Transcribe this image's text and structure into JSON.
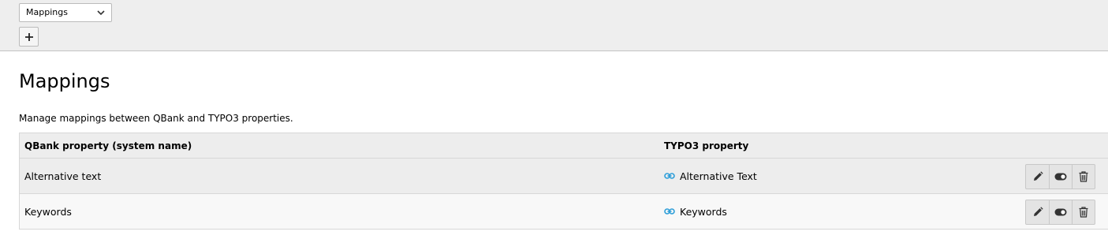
{
  "docheader": {
    "module_select": {
      "value": "Mappings"
    },
    "add_button": {
      "icon": "plus-icon"
    }
  },
  "page": {
    "title": "Mappings",
    "description": "Manage mappings between QBank and TYPO3 properties."
  },
  "table": {
    "columns": [
      "QBank property (system name)",
      "TYPO3 property"
    ],
    "rows": [
      {
        "qbank_property": "Alternative text",
        "typo3_property": "Alternative Text"
      },
      {
        "qbank_property": "Keywords",
        "typo3_property": "Keywords"
      }
    ],
    "row_actions": [
      "pencil-icon",
      "toggle-icon",
      "trash-icon"
    ]
  },
  "colors": {
    "header_bg": "#eeeeee",
    "link_icon": "#2f9fd9"
  }
}
